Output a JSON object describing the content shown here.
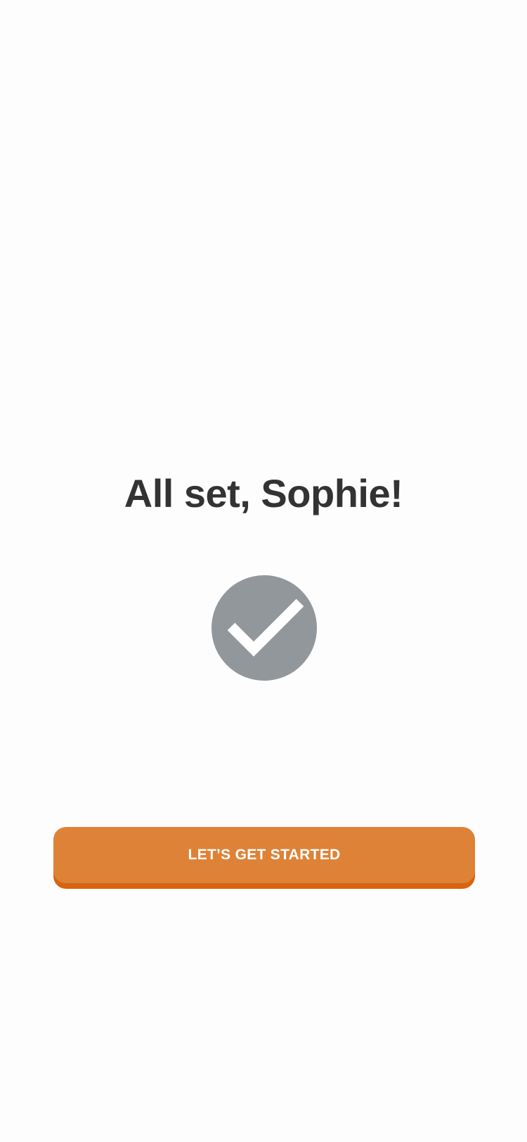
{
  "screen": {
    "title": "All set, Sophie!",
    "status_icon": "check-circle-icon",
    "cta_label": "LET’S GET STARTED"
  },
  "colors": {
    "background": "#fdfdfd",
    "title_text": "#333333",
    "check_circle": "#92979c",
    "button": "#de8238",
    "button_shadow": "#d9640f",
    "button_text": "#ffffff"
  }
}
